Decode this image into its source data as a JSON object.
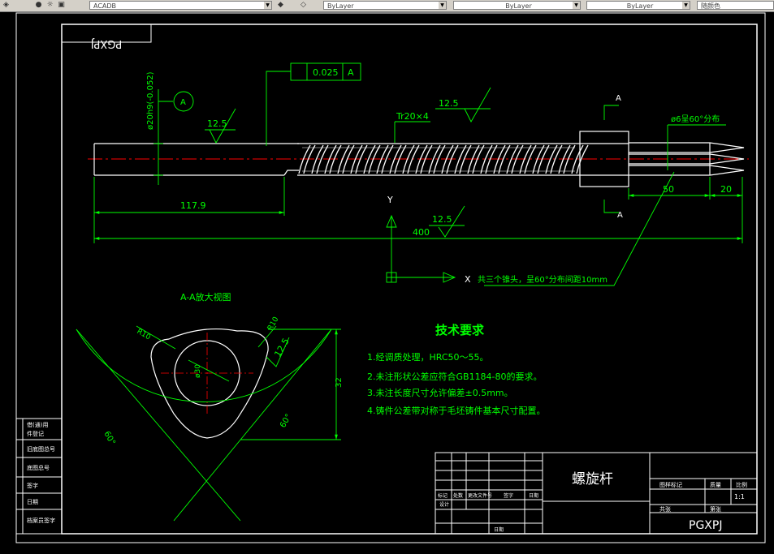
{
  "toolbar": {
    "text_style": "ACADB",
    "layer_combo_1": "ByLayer",
    "layer_combo_2": "ByLayer",
    "layer_combo_3": "ByLayer",
    "plot_style": "随颜色"
  },
  "drawing": {
    "mirrored_code": "PGXPJ",
    "flatness": "0.025",
    "datum": "A",
    "datum_symbol": "A",
    "shaft_diameter": "ø20h9(-0.052)",
    "roughness_1": "12.5",
    "roughness_2": "12.5",
    "roughness_3": "12.5",
    "roughness_4": "12.5",
    "thread_spec": "Tr20×4",
    "dim_117_9": "117.9",
    "dim_400": "400",
    "dim_50": "50",
    "dim_20": "20",
    "dim_32": "32",
    "dim_r10a": "R10",
    "dim_r10b": "R10",
    "dim_phi30": "ø30",
    "angle_60a": "60°",
    "angle_60b": "60°",
    "tips_note": "ø6呈60°分布",
    "section_label_a1": "A",
    "section_label_a2": "A",
    "axis_y": "Y",
    "axis_x": "X",
    "tips_callout": "共三个锥头，呈60°分布间距10mm",
    "section_title": "A-A放大视图",
    "tech_title": "技术要求",
    "tech_items": [
      "1.经调质处理，HRC50～55。",
      "2.未注形状公差应符合GB1184-80的要求。",
      "3.未注长度尺寸允许偏差±0.5mm。",
      "4.铸件公差带对称于毛坯铸件基本尺寸配置。"
    ]
  },
  "title_block": {
    "part_name": "螺旋杆",
    "code": "PGXPJ",
    "scale": "1:1",
    "hdr_stage": "图样标记",
    "hdr_weight": "质量",
    "hdr_scale": "比例",
    "row_sheets": "共张",
    "row_sheet": "第张",
    "hdr_mark": "标记",
    "hdr_count": "处数",
    "hdr_change_doc": "更改文件号",
    "hdr_sign": "签字",
    "hdr_date": "日期",
    "hdr_design": "设计",
    "hdr_approve": "日期"
  },
  "side_block": {
    "r1": "借(通)用",
    "r1b": "件登记",
    "r2": "旧底图总号",
    "r3": "底图总号",
    "r4": "签字",
    "r5": "日期",
    "r6": "档案员签字"
  },
  "colors": {
    "frame": "#ffffff",
    "dimension": "#00ff00",
    "center_line": "#ff0000",
    "leader": "#00e600"
  }
}
